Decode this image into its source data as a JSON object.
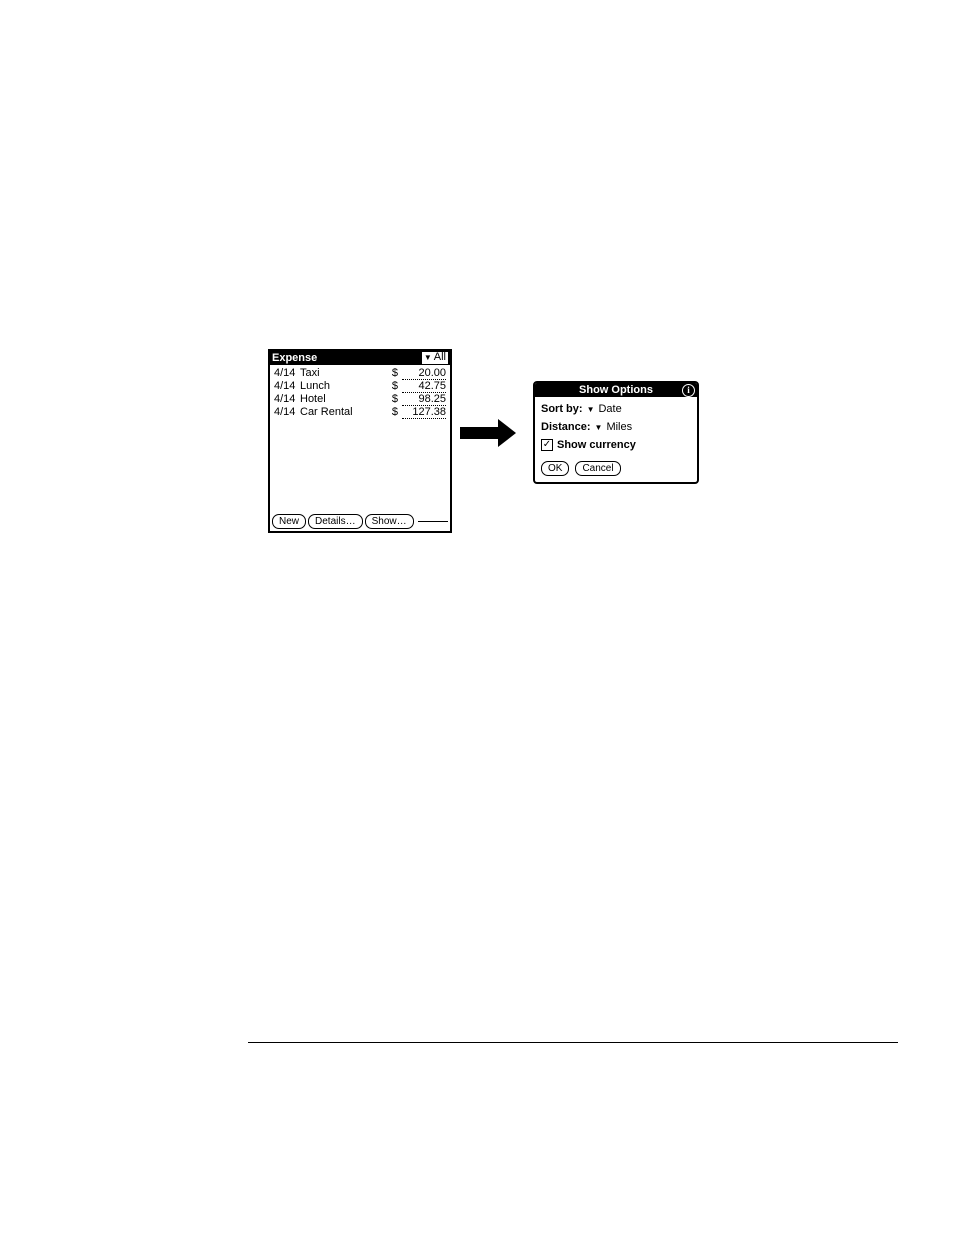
{
  "expense": {
    "title": "Expense",
    "filter_label": "All",
    "items": [
      {
        "date": "4/14",
        "desc": "Taxi",
        "currency": "$",
        "amount": "20.00"
      },
      {
        "date": "4/14",
        "desc": "Lunch",
        "currency": "$",
        "amount": "42.75"
      },
      {
        "date": "4/14",
        "desc": "Hotel",
        "currency": "$",
        "amount": "98.25"
      },
      {
        "date": "4/14",
        "desc": "Car Rental",
        "currency": "$",
        "amount": "127.38"
      }
    ],
    "buttons": {
      "new": "New",
      "details": "Details…",
      "show": "Show…"
    }
  },
  "dialog": {
    "title": "Show Options",
    "info_glyph": "i",
    "sort_label": "Sort by:",
    "sort_value": "Date",
    "distance_label": "Distance:",
    "distance_value": "Miles",
    "show_currency_label": "Show currency",
    "show_currency_checked": true,
    "ok": "OK",
    "cancel": "Cancel"
  }
}
